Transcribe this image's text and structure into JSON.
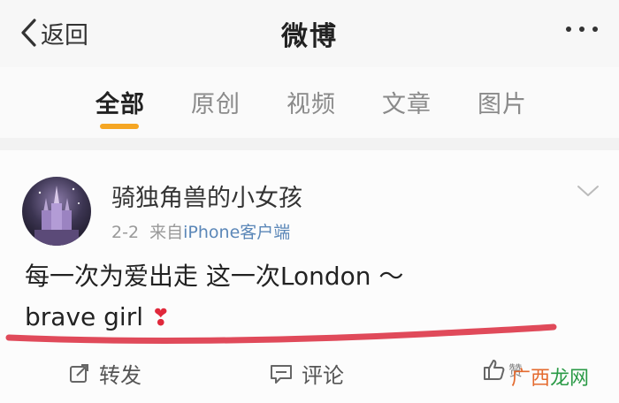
{
  "nav": {
    "back_label": "返回",
    "title": "微博"
  },
  "tabs": [
    {
      "label": "全部",
      "active": true
    },
    {
      "label": "原创",
      "active": false
    },
    {
      "label": "视频",
      "active": false
    },
    {
      "label": "文章",
      "active": false
    },
    {
      "label": "图片",
      "active": false
    }
  ],
  "post": {
    "username": "骑独角兽的小女孩",
    "date": "2-2",
    "source_prefix": "来自",
    "source": "iPhone客户端",
    "text_line1": "每一次为爱出走 这一次London ～",
    "text_line2": "brave girl",
    "emoji": "❣"
  },
  "actions": {
    "repost_label": "转发",
    "comment_label": "评论",
    "like_label": "赞"
  },
  "watermark": {
    "part1": "广西",
    "part2": "龙网"
  },
  "colors": {
    "tab_indicator": "#f5a623",
    "source_link": "#5b87b8",
    "annotation_line": "#e04a5a"
  }
}
